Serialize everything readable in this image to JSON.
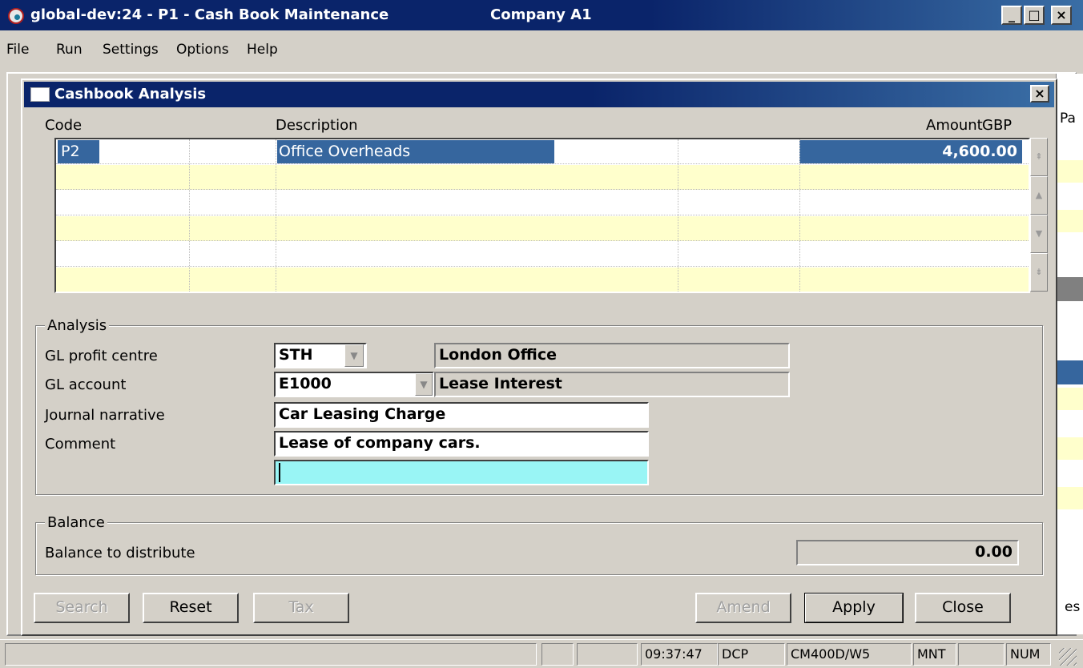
{
  "main_window": {
    "title": "global-dev:24 - P1 - Cash Book Maintenance",
    "company": "Company A1",
    "minimize": "_",
    "maximize": "□",
    "close": "×"
  },
  "menu": [
    "File",
    "Run",
    "Settings",
    "Options",
    "Help"
  ],
  "background": {
    "right_col_header": "Pa",
    "right_btn_text": "es"
  },
  "dialog": {
    "title": "Cashbook Analysis",
    "close": "×",
    "grid": {
      "headers": {
        "code": "Code",
        "description": "Description",
        "amount": "Amount",
        "currency": "GBP"
      },
      "rows": [
        {
          "code": "P2",
          "description": "Office Overheads",
          "amount": "4,600.00"
        }
      ]
    },
    "analysis": {
      "legend": "Analysis",
      "gl_profit_centre_label": "GL profit centre",
      "gl_profit_centre_value": "STH",
      "gl_profit_centre_desc": "London Office",
      "gl_account_label": "GL account",
      "gl_account_value": "E1000",
      "gl_account_desc": "Lease Interest",
      "journal_narrative_label": "Journal narrative",
      "journal_narrative_value": "Car Leasing Charge",
      "comment_label": "Comment",
      "comment_value": "Lease of company cars.",
      "comment_line2": ""
    },
    "balance": {
      "legend": "Balance",
      "label": "Balance to distribute",
      "value": "0.00"
    },
    "buttons": {
      "search": "Search",
      "reset": "Reset",
      "tax": "Tax",
      "amend": "Amend",
      "apply": "Apply",
      "close": "Close"
    }
  },
  "status": {
    "time": "09:37:47",
    "user": "DCP",
    "terminal": "CM400D/W5",
    "mode": "MNT",
    "num": "NUM"
  },
  "icons": {
    "scroll_top": "⇞",
    "scroll_up": "▲",
    "scroll_down": "▼",
    "scroll_bottom": "⇟",
    "dropdown": "▼"
  }
}
